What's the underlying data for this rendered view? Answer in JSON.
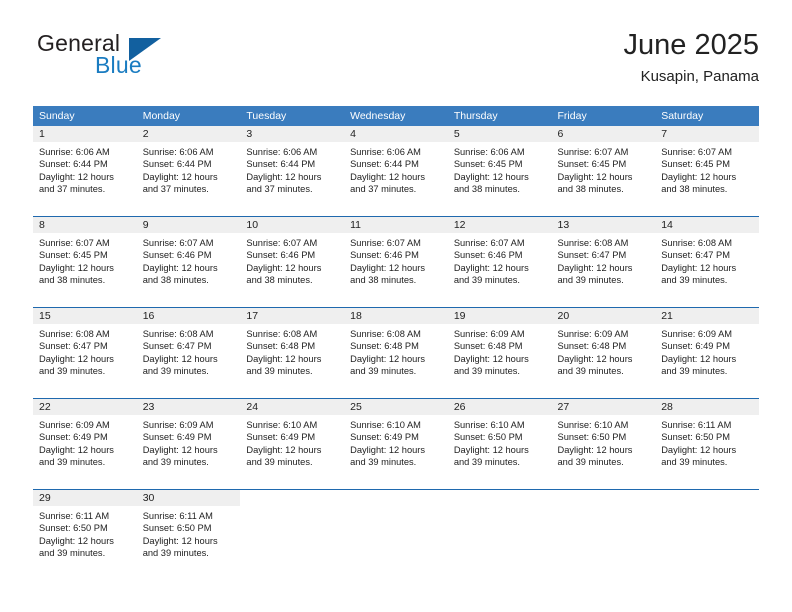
{
  "brand": {
    "name_part1": "General",
    "name_part2": "Blue",
    "logo_icon": "blue-triangle-icon",
    "accent_color": "#1a7cc1",
    "triangle_color": "#12609f"
  },
  "header": {
    "title": "June 2025",
    "subtitle": "Kusapin, Panama"
  },
  "calendar": {
    "header_bg_color": "#3a7cbe",
    "daynum_band_color": "#efefef",
    "row_separator_color": "#1f69ae",
    "weekday_headers": [
      "Sunday",
      "Monday",
      "Tuesday",
      "Wednesday",
      "Thursday",
      "Friday",
      "Saturday"
    ],
    "weeks": [
      [
        {
          "day": "1",
          "sunrise": "Sunrise: 6:06 AM",
          "sunset": "Sunset: 6:44 PM",
          "daylight": "Daylight: 12 hours and 37 minutes."
        },
        {
          "day": "2",
          "sunrise": "Sunrise: 6:06 AM",
          "sunset": "Sunset: 6:44 PM",
          "daylight": "Daylight: 12 hours and 37 minutes."
        },
        {
          "day": "3",
          "sunrise": "Sunrise: 6:06 AM",
          "sunset": "Sunset: 6:44 PM",
          "daylight": "Daylight: 12 hours and 37 minutes."
        },
        {
          "day": "4",
          "sunrise": "Sunrise: 6:06 AM",
          "sunset": "Sunset: 6:44 PM",
          "daylight": "Daylight: 12 hours and 37 minutes."
        },
        {
          "day": "5",
          "sunrise": "Sunrise: 6:06 AM",
          "sunset": "Sunset: 6:45 PM",
          "daylight": "Daylight: 12 hours and 38 minutes."
        },
        {
          "day": "6",
          "sunrise": "Sunrise: 6:07 AM",
          "sunset": "Sunset: 6:45 PM",
          "daylight": "Daylight: 12 hours and 38 minutes."
        },
        {
          "day": "7",
          "sunrise": "Sunrise: 6:07 AM",
          "sunset": "Sunset: 6:45 PM",
          "daylight": "Daylight: 12 hours and 38 minutes."
        }
      ],
      [
        {
          "day": "8",
          "sunrise": "Sunrise: 6:07 AM",
          "sunset": "Sunset: 6:45 PM",
          "daylight": "Daylight: 12 hours and 38 minutes."
        },
        {
          "day": "9",
          "sunrise": "Sunrise: 6:07 AM",
          "sunset": "Sunset: 6:46 PM",
          "daylight": "Daylight: 12 hours and 38 minutes."
        },
        {
          "day": "10",
          "sunrise": "Sunrise: 6:07 AM",
          "sunset": "Sunset: 6:46 PM",
          "daylight": "Daylight: 12 hours and 38 minutes."
        },
        {
          "day": "11",
          "sunrise": "Sunrise: 6:07 AM",
          "sunset": "Sunset: 6:46 PM",
          "daylight": "Daylight: 12 hours and 38 minutes."
        },
        {
          "day": "12",
          "sunrise": "Sunrise: 6:07 AM",
          "sunset": "Sunset: 6:46 PM",
          "daylight": "Daylight: 12 hours and 39 minutes."
        },
        {
          "day": "13",
          "sunrise": "Sunrise: 6:08 AM",
          "sunset": "Sunset: 6:47 PM",
          "daylight": "Daylight: 12 hours and 39 minutes."
        },
        {
          "day": "14",
          "sunrise": "Sunrise: 6:08 AM",
          "sunset": "Sunset: 6:47 PM",
          "daylight": "Daylight: 12 hours and 39 minutes."
        }
      ],
      [
        {
          "day": "15",
          "sunrise": "Sunrise: 6:08 AM",
          "sunset": "Sunset: 6:47 PM",
          "daylight": "Daylight: 12 hours and 39 minutes."
        },
        {
          "day": "16",
          "sunrise": "Sunrise: 6:08 AM",
          "sunset": "Sunset: 6:47 PM",
          "daylight": "Daylight: 12 hours and 39 minutes."
        },
        {
          "day": "17",
          "sunrise": "Sunrise: 6:08 AM",
          "sunset": "Sunset: 6:48 PM",
          "daylight": "Daylight: 12 hours and 39 minutes."
        },
        {
          "day": "18",
          "sunrise": "Sunrise: 6:08 AM",
          "sunset": "Sunset: 6:48 PM",
          "daylight": "Daylight: 12 hours and 39 minutes."
        },
        {
          "day": "19",
          "sunrise": "Sunrise: 6:09 AM",
          "sunset": "Sunset: 6:48 PM",
          "daylight": "Daylight: 12 hours and 39 minutes."
        },
        {
          "day": "20",
          "sunrise": "Sunrise: 6:09 AM",
          "sunset": "Sunset: 6:48 PM",
          "daylight": "Daylight: 12 hours and 39 minutes."
        },
        {
          "day": "21",
          "sunrise": "Sunrise: 6:09 AM",
          "sunset": "Sunset: 6:49 PM",
          "daylight": "Daylight: 12 hours and 39 minutes."
        }
      ],
      [
        {
          "day": "22",
          "sunrise": "Sunrise: 6:09 AM",
          "sunset": "Sunset: 6:49 PM",
          "daylight": "Daylight: 12 hours and 39 minutes."
        },
        {
          "day": "23",
          "sunrise": "Sunrise: 6:09 AM",
          "sunset": "Sunset: 6:49 PM",
          "daylight": "Daylight: 12 hours and 39 minutes."
        },
        {
          "day": "24",
          "sunrise": "Sunrise: 6:10 AM",
          "sunset": "Sunset: 6:49 PM",
          "daylight": "Daylight: 12 hours and 39 minutes."
        },
        {
          "day": "25",
          "sunrise": "Sunrise: 6:10 AM",
          "sunset": "Sunset: 6:49 PM",
          "daylight": "Daylight: 12 hours and 39 minutes."
        },
        {
          "day": "26",
          "sunrise": "Sunrise: 6:10 AM",
          "sunset": "Sunset: 6:50 PM",
          "daylight": "Daylight: 12 hours and 39 minutes."
        },
        {
          "day": "27",
          "sunrise": "Sunrise: 6:10 AM",
          "sunset": "Sunset: 6:50 PM",
          "daylight": "Daylight: 12 hours and 39 minutes."
        },
        {
          "day": "28",
          "sunrise": "Sunrise: 6:11 AM",
          "sunset": "Sunset: 6:50 PM",
          "daylight": "Daylight: 12 hours and 39 minutes."
        }
      ],
      [
        {
          "day": "29",
          "sunrise": "Sunrise: 6:11 AM",
          "sunset": "Sunset: 6:50 PM",
          "daylight": "Daylight: 12 hours and 39 minutes."
        },
        {
          "day": "30",
          "sunrise": "Sunrise: 6:11 AM",
          "sunset": "Sunset: 6:50 PM",
          "daylight": "Daylight: 12 hours and 39 minutes."
        },
        null,
        null,
        null,
        null,
        null
      ]
    ]
  }
}
